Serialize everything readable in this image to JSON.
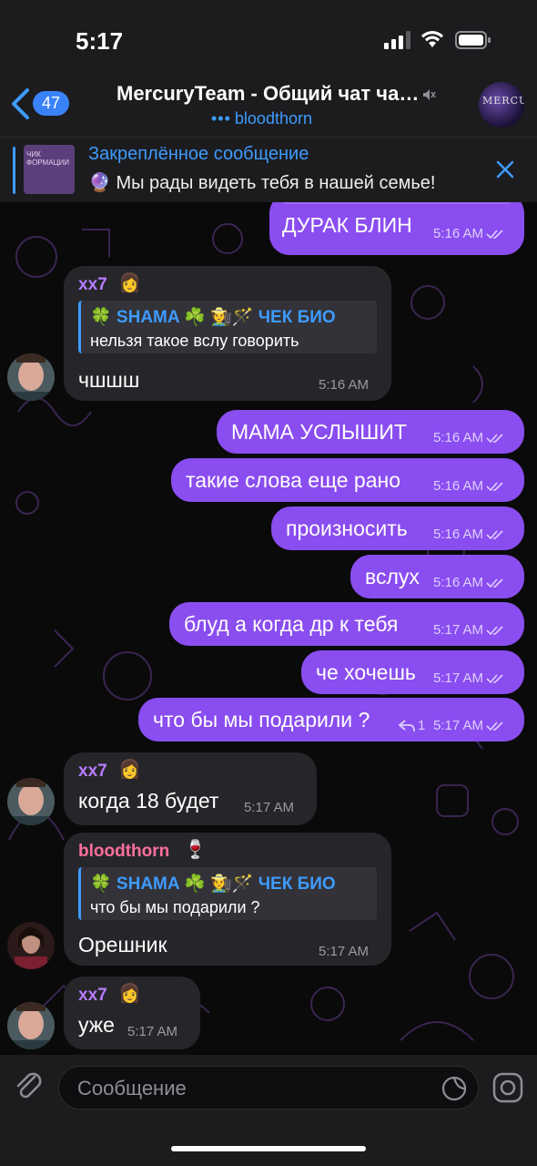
{
  "status_bar": {
    "time": "5:17"
  },
  "header": {
    "back_count": "47",
    "title": "MercuryTeam - Общий чат чатик",
    "subtitle": "bloodthorn",
    "avatar_text": "MERCURY"
  },
  "pinned": {
    "title": "Закреплённое сообщение",
    "text": "🔮 Мы рады видеть тебя в нашей семье!",
    "thumb_text": "ЧИК ФОРМАЦИИ"
  },
  "messages": [
    {
      "text": "ДУРАК БЛИН",
      "time": "5:16 AM"
    },
    {
      "sender": "xx7",
      "reply_name": "🍀 SHAMA ☘️ 🧑‍🌾🪄 ЧЕК БИО",
      "reply_text": "нельзя такое вслу говорить",
      "text": "чшшш",
      "time": "5:16 AM"
    },
    {
      "text": "МАМА УСЛЫШИТ",
      "time": "5:16 AM"
    },
    {
      "text": "такие слова еще рано",
      "time": "5:16 AM"
    },
    {
      "text": "произносить",
      "time": "5:16 AM"
    },
    {
      "text": "вслух",
      "time": "5:16 AM"
    },
    {
      "text": "блуд а когда др к тебя",
      "time": "5:17 AM"
    },
    {
      "text": "че хочешь",
      "time": "5:17 AM"
    },
    {
      "text": "что бы мы подарили ?",
      "reply_count": "1",
      "time": "5:17 AM"
    },
    {
      "sender": "xx7",
      "text": "когда 18 будет",
      "time": "5:17 AM"
    },
    {
      "sender": "bloodthorn",
      "reply_name": "🍀 SHAMA ☘️ 🧑‍🌾🪄 ЧЕК БИО",
      "reply_text": "что бы мы подарили ?",
      "text": "Орешник",
      "time": "5:17 AM"
    },
    {
      "sender": "xx7",
      "text": "уже",
      "time": "5:17 AM"
    }
  ],
  "input": {
    "placeholder": "Сообщение"
  },
  "colors": {
    "accent": "#3e9bff",
    "outgoing": "#8a4df0",
    "incoming": "#26262a",
    "sender_xx7": "#b67cff",
    "sender_bloodthorn": "#ff6f9d"
  }
}
